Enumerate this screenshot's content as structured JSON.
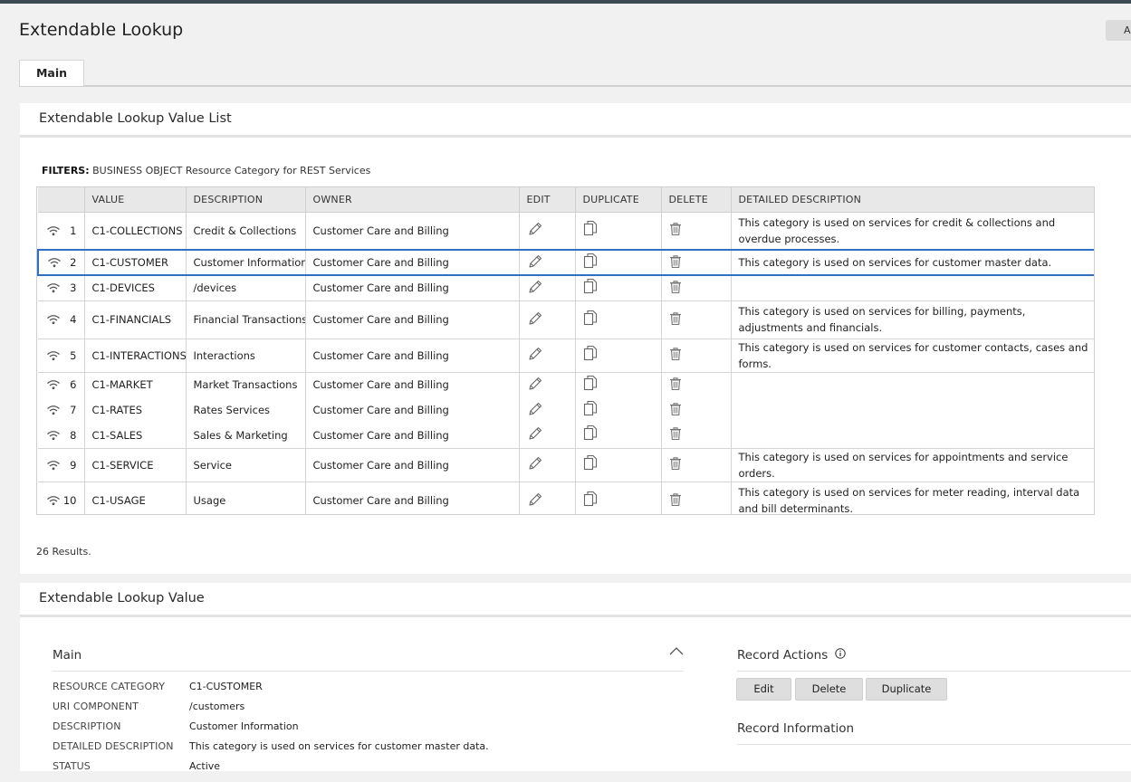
{
  "page": {
    "title": "Extendable Lookup",
    "top_action_label": "A"
  },
  "tabs": [
    {
      "label": "Main",
      "active": true
    }
  ],
  "list_panel": {
    "title": "Extendable Lookup Value List",
    "filters_label": "FILTERS:",
    "filter_key": "BUSINESS OBJECT",
    "filter_value": "Resource Category for REST Services",
    "columns": [
      "",
      "VALUE",
      "DESCRIPTION",
      "OWNER",
      "EDIT",
      "DUPLICATE",
      "DELETE",
      "DETAILED DESCRIPTION"
    ],
    "rows": [
      {
        "num": "1",
        "value": "C1-COLLECTIONS",
        "description": "Credit & Collections",
        "owner": "Customer Care and Billing",
        "detailed": "This category is used on services for credit & collections and overdue processes."
      },
      {
        "num": "2",
        "value": "C1-CUSTOMER",
        "description": "Customer Information",
        "owner": "Customer Care and Billing",
        "detailed": "This category is used on services for customer master data."
      },
      {
        "num": "3",
        "value": "C1-DEVICES",
        "description": "/devices",
        "owner": "Customer Care and Billing",
        "detailed": ""
      },
      {
        "num": "4",
        "value": "C1-FINANCIALS",
        "description": "Financial Transactions",
        "owner": "Customer Care and Billing",
        "detailed": "This category is used on services for billing, payments, adjustments and financials."
      },
      {
        "num": "5",
        "value": "C1-INTERACTIONS",
        "description": "Interactions",
        "owner": "Customer Care and Billing",
        "detailed": "This category is used on services for customer contacts, cases and forms."
      },
      {
        "num": "6",
        "value": "C1-MARKET",
        "description": "Market Transactions",
        "owner": "Customer Care and Billing",
        "detailed": ""
      },
      {
        "num": "7",
        "value": "C1-RATES",
        "description": "Rates Services",
        "owner": "Customer Care and Billing",
        "detailed": ""
      },
      {
        "num": "8",
        "value": "C1-SALES",
        "description": "Sales & Marketing",
        "owner": "Customer Care and Billing",
        "detailed": ""
      },
      {
        "num": "9",
        "value": "C1-SERVICE",
        "description": "Service",
        "owner": "Customer Care and Billing",
        "detailed": "This category is used on services for appointments and service orders."
      },
      {
        "num": "10",
        "value": "C1-USAGE",
        "description": "Usage",
        "owner": "Customer Care and Billing",
        "detailed": "This category is used on services for meter reading, interval data and bill determinants."
      }
    ],
    "results_text": "26 Results."
  },
  "detail_panel": {
    "title": "Extendable Lookup Value",
    "section_title": "Main",
    "fields": [
      {
        "label": "RESOURCE CATEGORY",
        "value": "C1-CUSTOMER"
      },
      {
        "label": "URI COMPONENT",
        "value": "/customers"
      },
      {
        "label": "DESCRIPTION",
        "value": "Customer Information"
      },
      {
        "label": "DETAILED DESCRIPTION",
        "value": "This category is used on services for customer master data."
      },
      {
        "label": "STATUS",
        "value": "Active"
      }
    ],
    "record_actions_title": "Record Actions",
    "actions": {
      "edit": "Edit",
      "delete": "Delete",
      "duplicate": "Duplicate"
    },
    "record_information_title": "Record Information"
  },
  "colors": {
    "selection": "#2f6fc4",
    "topbar": "#3c4a54",
    "page_bg": "#f1f1f1"
  }
}
